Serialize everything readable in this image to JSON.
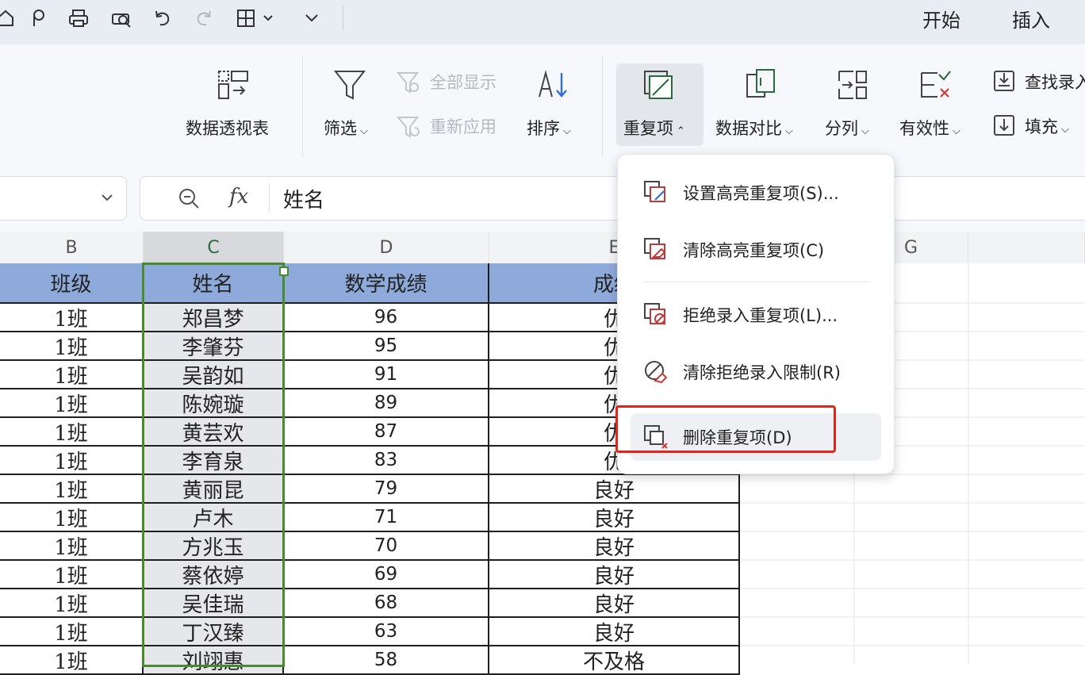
{
  "menu_tabs": [
    "开始",
    "插入"
  ],
  "ribbon": {
    "pivot_label": "数据透视表",
    "filter_label": "筛选",
    "show_all_label": "全部显示",
    "reapply_label": "重新应用",
    "sort_label": "排序",
    "duplicates_label": "重复项",
    "compare_label": "数据对比",
    "split_label": "分列",
    "validity_label": "有效性",
    "lookup_label": "查找录入",
    "fill_label": "填充"
  },
  "formula_bar": {
    "fx_label": "fx",
    "content": "姓名"
  },
  "columns": [
    "B",
    "C",
    "D",
    "E",
    "G"
  ],
  "table": {
    "headers": [
      "班级",
      "姓名",
      "数学成绩",
      "成绩"
    ],
    "rows": [
      [
        "1班",
        "郑昌梦",
        "96",
        "优"
      ],
      [
        "1班",
        "李肇芬",
        "95",
        "优"
      ],
      [
        "1班",
        "吴韵如",
        "91",
        "优"
      ],
      [
        "1班",
        "陈婉璇",
        "89",
        "优"
      ],
      [
        "1班",
        "黄芸欢",
        "87",
        "优"
      ],
      [
        "1班",
        "李育泉",
        "83",
        "优"
      ],
      [
        "1班",
        "黄丽昆",
        "79",
        "良好"
      ],
      [
        "1班",
        "卢木",
        "71",
        "良好"
      ],
      [
        "1班",
        "方兆玉",
        "70",
        "良好"
      ],
      [
        "1班",
        "蔡依婷",
        "69",
        "良好"
      ],
      [
        "1班",
        "吴佳瑞",
        "68",
        "良好"
      ],
      [
        "1班",
        "丁汉臻",
        "63",
        "良好"
      ],
      [
        "1班",
        "刘翊惠",
        "58",
        "不及格"
      ]
    ]
  },
  "dropdown": {
    "items": [
      "设置高亮重复项(S)...",
      "清除高亮重复项(C)",
      "拒绝录入重复项(L)...",
      "清除拒绝录入限制(R)",
      "删除重复项(D)"
    ]
  },
  "colors": {
    "header_fill": "#8eaadb",
    "selection_border": "#4a8a2e",
    "highlight_box": "#e0261c",
    "accent": "#2b6a3a"
  }
}
